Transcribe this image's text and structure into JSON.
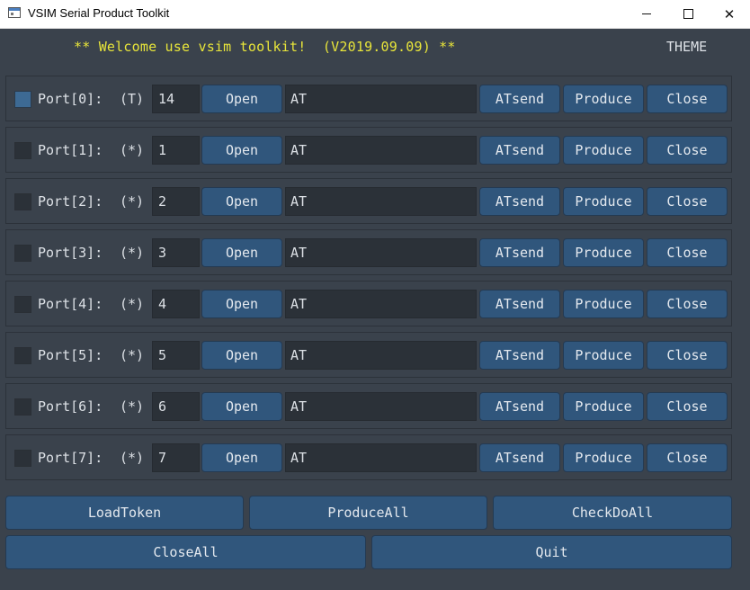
{
  "window": {
    "title": "VSIM Serial Product Toolkit",
    "minimize_symbol": "—",
    "maximize_symbol": "□",
    "close_symbol": "✕"
  },
  "header": {
    "welcome": "** Welcome use vsim toolkit!  (V2019.09.09) **",
    "theme_label": "THEME"
  },
  "colors": {
    "background": "#3a424c",
    "button": "#30567c",
    "input": "#2b3138",
    "welcome_text": "#e8e53a",
    "text": "#dde1e6"
  },
  "ports": [
    {
      "label": "Port[0]:",
      "flag": "(T)",
      "value": "14",
      "checked": true,
      "open": "Open",
      "cmd": "AT",
      "atsend": "ATsend",
      "produce": "Produce",
      "close": "Close"
    },
    {
      "label": "Port[1]:",
      "flag": "(*)",
      "value": "1",
      "checked": false,
      "open": "Open",
      "cmd": "AT",
      "atsend": "ATsend",
      "produce": "Produce",
      "close": "Close"
    },
    {
      "label": "Port[2]:",
      "flag": "(*)",
      "value": "2",
      "checked": false,
      "open": "Open",
      "cmd": "AT",
      "atsend": "ATsend",
      "produce": "Produce",
      "close": "Close"
    },
    {
      "label": "Port[3]:",
      "flag": "(*)",
      "value": "3",
      "checked": false,
      "open": "Open",
      "cmd": "AT",
      "atsend": "ATsend",
      "produce": "Produce",
      "close": "Close"
    },
    {
      "label": "Port[4]:",
      "flag": "(*)",
      "value": "4",
      "checked": false,
      "open": "Open",
      "cmd": "AT",
      "atsend": "ATsend",
      "produce": "Produce",
      "close": "Close"
    },
    {
      "label": "Port[5]:",
      "flag": "(*)",
      "value": "5",
      "checked": false,
      "open": "Open",
      "cmd": "AT",
      "atsend": "ATsend",
      "produce": "Produce",
      "close": "Close"
    },
    {
      "label": "Port[6]:",
      "flag": "(*)",
      "value": "6",
      "checked": false,
      "open": "Open",
      "cmd": "AT",
      "atsend": "ATsend",
      "produce": "Produce",
      "close": "Close"
    },
    {
      "label": "Port[7]:",
      "flag": "(*)",
      "value": "7",
      "checked": false,
      "open": "Open",
      "cmd": "AT",
      "atsend": "ATsend",
      "produce": "Produce",
      "close": "Close"
    }
  ],
  "bottom": {
    "load_token": "LoadToken",
    "produce_all": "ProduceAll",
    "check_do_all": "CheckDoAll",
    "close_all": "CloseAll",
    "quit": "Quit"
  }
}
